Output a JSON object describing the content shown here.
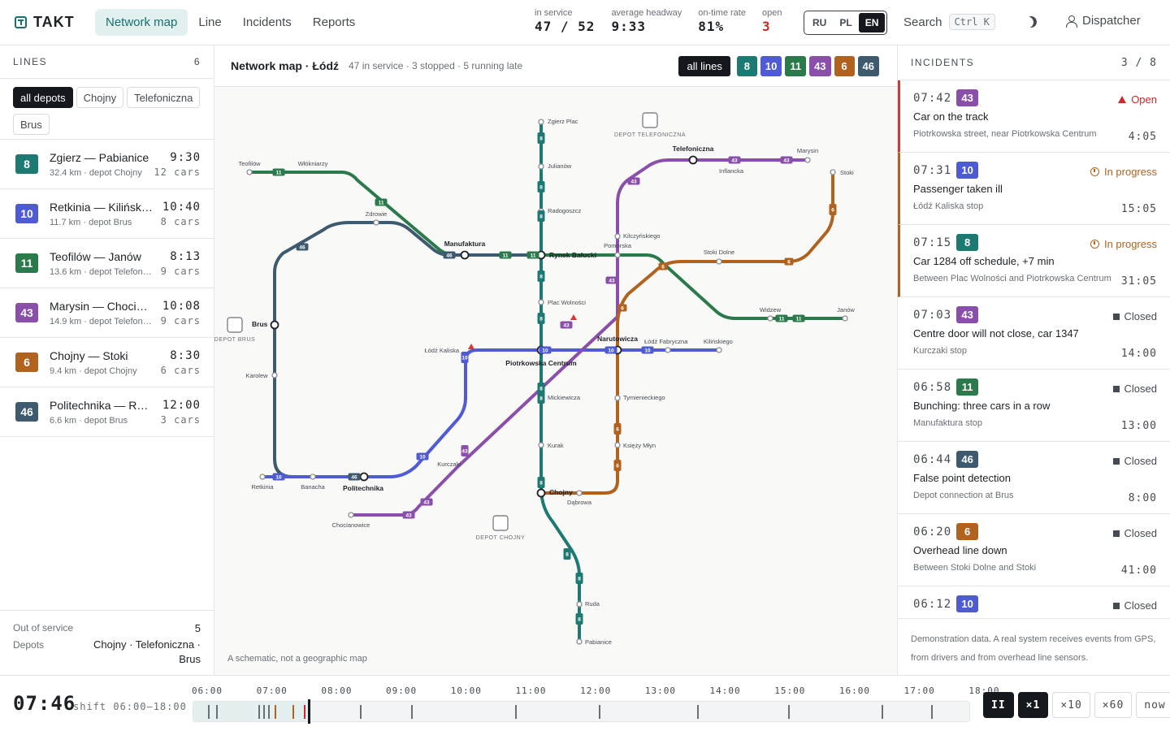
{
  "app": {
    "brand": "TAKT"
  },
  "nav": [
    {
      "label": "Network map",
      "active": true
    },
    {
      "label": "Line"
    },
    {
      "label": "Incidents"
    },
    {
      "label": "Reports"
    }
  ],
  "stats": [
    {
      "label": "in service",
      "value": "47 / 52"
    },
    {
      "label": "average headway",
      "value": "9:33"
    },
    {
      "label": "on-time rate",
      "value": "81%"
    },
    {
      "label": "open",
      "value": "3"
    }
  ],
  "languages": [
    {
      "label": "RU"
    },
    {
      "label": "PL"
    },
    {
      "label": "EN",
      "active": true
    }
  ],
  "search": {
    "label": "Search",
    "shortcut": "Ctrl K"
  },
  "user": {
    "label": "Dispatcher"
  },
  "line_colors": {
    "8": "#1d7a72",
    "10": "#4f5bd5",
    "11": "#2b7a4b",
    "43": "#8a4fab",
    "6": "#b0621e",
    "46": "#3e5a6e"
  },
  "lines_panel": {
    "title": "LINES",
    "count": "6",
    "filters": [
      {
        "label": "all depots",
        "active": true
      },
      {
        "label": "Chojny"
      },
      {
        "label": "Telefoniczna"
      },
      {
        "label": "Brus"
      }
    ],
    "items": [
      {
        "num": "8",
        "name": "Zgierz — Pabianice",
        "meta": "32.4 km · depot Chojny",
        "headway": "9:30",
        "cars": "12 cars"
      },
      {
        "num": "10",
        "name": "Retkinia — Kilińskiego",
        "meta": "11.7 km · depot Brus",
        "headway": "10:40",
        "cars": "8 cars"
      },
      {
        "num": "11",
        "name": "Teofilów — Janów",
        "meta": "13.6 km · depot Telefoniczna",
        "headway": "8:13",
        "cars": "9 cars"
      },
      {
        "num": "43",
        "name": "Marysin — Chocianowice",
        "meta": "14.9 km · depot Telefoniczna",
        "headway": "10:08",
        "cars": "9 cars"
      },
      {
        "num": "6",
        "name": "Chojny — Stoki",
        "meta": "9.4 km · depot Chojny",
        "headway": "8:30",
        "cars": "6 cars"
      },
      {
        "num": "46",
        "name": "Politechnika — Rynek Bałucki",
        "meta": "6.6 km · depot Brus",
        "headway": "12:00",
        "cars": "3 cars"
      }
    ],
    "footer": {
      "out_label": "Out of service",
      "out_value": "5",
      "depots_label": "Depots",
      "depots_value": "Chojny · Telefoniczna · Brus"
    }
  },
  "map": {
    "title": "Network map · Łódź",
    "subtitle": "47 in service · 3 stopped · 5 running late",
    "filter_all": "all lines",
    "filter_lines": [
      "8",
      "10",
      "11",
      "43",
      "6",
      "46"
    ],
    "note": "A schematic, not a geographic map",
    "depots": [
      "DEPOT TELEFONICZNA",
      "DEPOT BRUS",
      "DEPOT CHOJNY"
    ],
    "stations": [
      "Zgierz Plac",
      "Julianów",
      "Radogoszcz",
      "Teofilów",
      "Włókniarzy",
      "Zdrowie",
      "Manufaktura",
      "Rynek Bałucki",
      "Telefoniczna",
      "Inflancka",
      "Marysin",
      "Stoki",
      "Kilczyńskiego",
      "Pomorska",
      "Stoki Dolne",
      "Widzew",
      "Janów",
      "Plac Wolności",
      "Brus",
      "Łódź Kaliska",
      "Narutowicza",
      "Łódź Fabryczna",
      "Kilińskiego",
      "Piotrkowska Centrum",
      "Karolew",
      "Mickiewicza",
      "Tymienieckiego",
      "Kurak",
      "Księży Młyn",
      "Kurczaki",
      "Retkinia",
      "Banacha",
      "Politechnika",
      "Chojny",
      "Dąbrowa",
      "Chocianowice",
      "Ruda",
      "Pabianice"
    ]
  },
  "incidents_panel": {
    "title": "INCIDENTS",
    "count": "3 / 8",
    "items": [
      {
        "time": "07:42",
        "line": "43",
        "status": "Open",
        "kind": "open",
        "title": "Car on the track",
        "location": "Piotrkowska street, near Piotrkowska Centrum",
        "duration": "4:05"
      },
      {
        "time": "07:31",
        "line": "10",
        "status": "In progress",
        "kind": "progress",
        "title": "Passenger taken ill",
        "location": "Łódź Kaliska stop",
        "duration": "15:05"
      },
      {
        "time": "07:15",
        "line": "8",
        "status": "In progress",
        "kind": "progress",
        "title": "Car 1284 off schedule, +7 min",
        "location": "Between Plac Wolności and Piotrkowska Centrum",
        "duration": "31:05"
      },
      {
        "time": "07:03",
        "line": "43",
        "status": "Closed",
        "kind": "closed",
        "title": "Centre door will not close, car 1347",
        "location": "Kurczaki stop",
        "duration": "14:00"
      },
      {
        "time": "06:58",
        "line": "11",
        "status": "Closed",
        "kind": "closed",
        "title": "Bunching: three cars in a row",
        "location": "Manufaktura stop",
        "duration": "13:00"
      },
      {
        "time": "06:44",
        "line": "46",
        "status": "Closed",
        "kind": "closed",
        "title": "False point detection",
        "location": "Depot connection at Brus",
        "duration": "8:00"
      },
      {
        "time": "06:20",
        "line": "6",
        "status": "Closed",
        "kind": "closed",
        "title": "Overhead line down",
        "location": "Between Stoki Dolne and Stoki",
        "duration": "41:00"
      },
      {
        "time": "06:12",
        "line": "10",
        "status": "Closed",
        "kind": "closed",
        "title": "",
        "location": "",
        "duration": ""
      }
    ],
    "footer": "Demonstration data. A real system receives events from GPS, from drivers and from overhead line sensors."
  },
  "timeline": {
    "now": "07:46",
    "shift": "shift 06:00–18:00",
    "ticks": [
      "06:00",
      "07:00",
      "08:00",
      "09:00",
      "10:00",
      "11:00",
      "12:00",
      "13:00",
      "14:00",
      "15:00",
      "16:00",
      "17:00",
      "18:00"
    ],
    "controls": [
      "II",
      "×1",
      "×10",
      "×60",
      "now"
    ]
  }
}
